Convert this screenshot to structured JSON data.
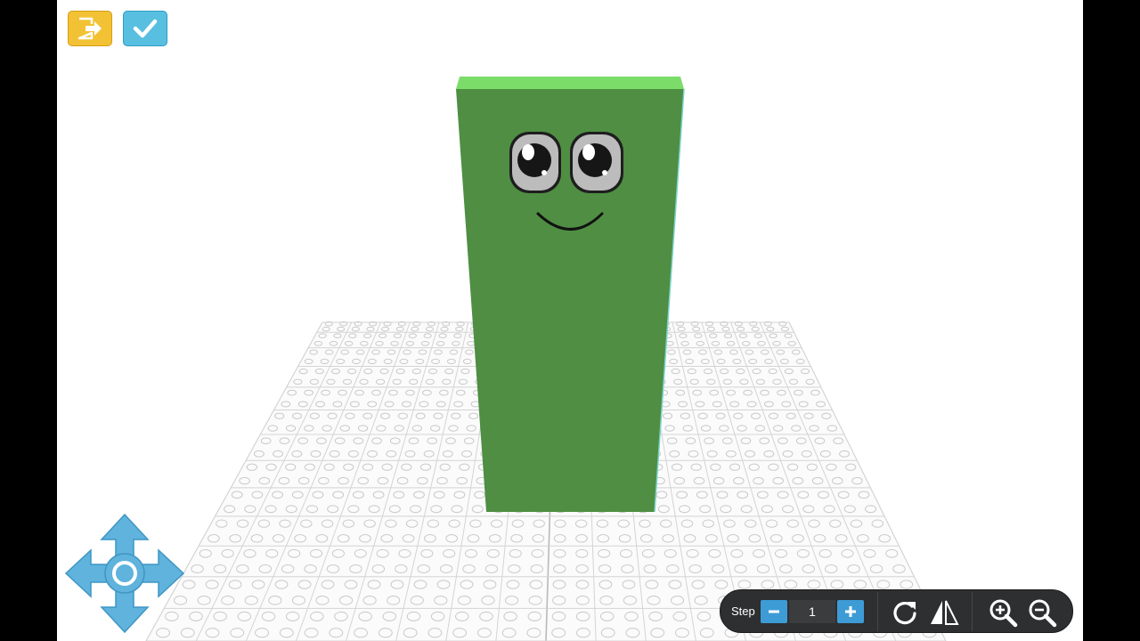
{
  "app": {
    "exit_icon": "exit-door-icon",
    "done_icon": "checkmark-icon"
  },
  "toolbar": {
    "step_label": "Step",
    "step_value": "1",
    "minus_icon": "minus-icon",
    "plus_icon": "plus-icon",
    "rotate_icon": "rotate-icon",
    "mirror_icon": "mirror-flip-icon",
    "zoom_in_icon": "zoom-in-icon",
    "zoom_out_icon": "zoom-out-icon"
  },
  "navigation": {
    "pad_icon": "move-arrows-icon"
  },
  "colors": {
    "block_front": "#4f8e43",
    "block_top": "#7bdc6a",
    "exit_button": "#f3c234",
    "done_button": "#58bfe0",
    "step_buttons": "#3d9cd6",
    "toolbar_bg": "#2e2f31",
    "dpad": "#5fb3dc"
  }
}
